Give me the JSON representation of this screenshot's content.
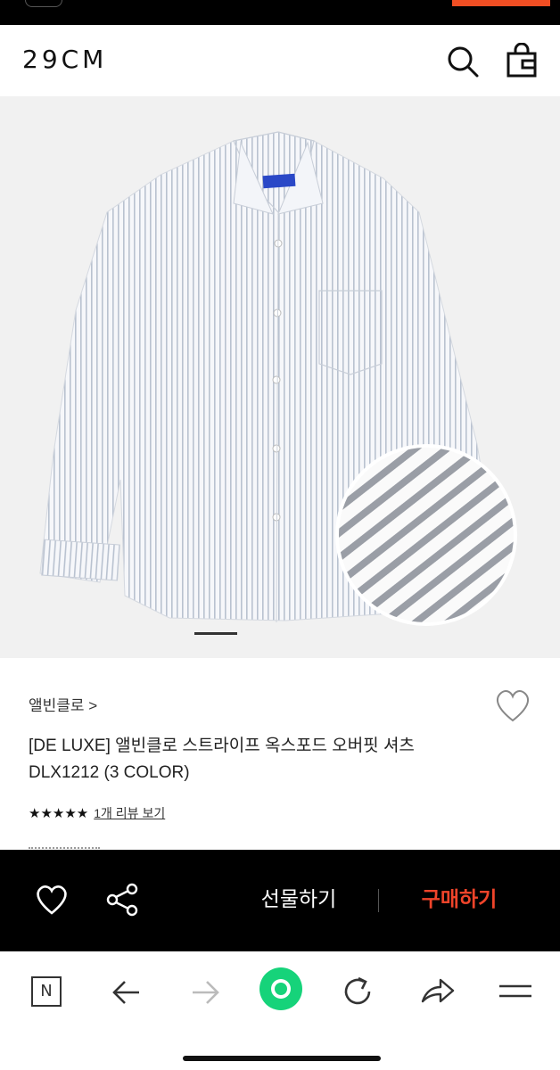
{
  "header": {
    "logo": "29CM",
    "search_icon": "search-icon",
    "bag_icon": "shopping-bag-icon"
  },
  "gallery": {
    "image_alt": "striped oxford overfit shirt",
    "current_slide": 1
  },
  "product": {
    "brand": "앨빈클로 >",
    "title": "[DE LUXE] 앨빈클로 스트라이프 옥스포드 오버핏 셔츠 DLX1212 (3 COLOR)",
    "stars": "★★★★★",
    "rating": 5,
    "review_link": "1개 리뷰 보기"
  },
  "action_bar": {
    "gift_label": "선물하기",
    "buy_label": "구매하기"
  },
  "browser_nav": {
    "n_label": "N"
  },
  "colors": {
    "accent": "#f0442a",
    "home_green": "#16d37a"
  }
}
